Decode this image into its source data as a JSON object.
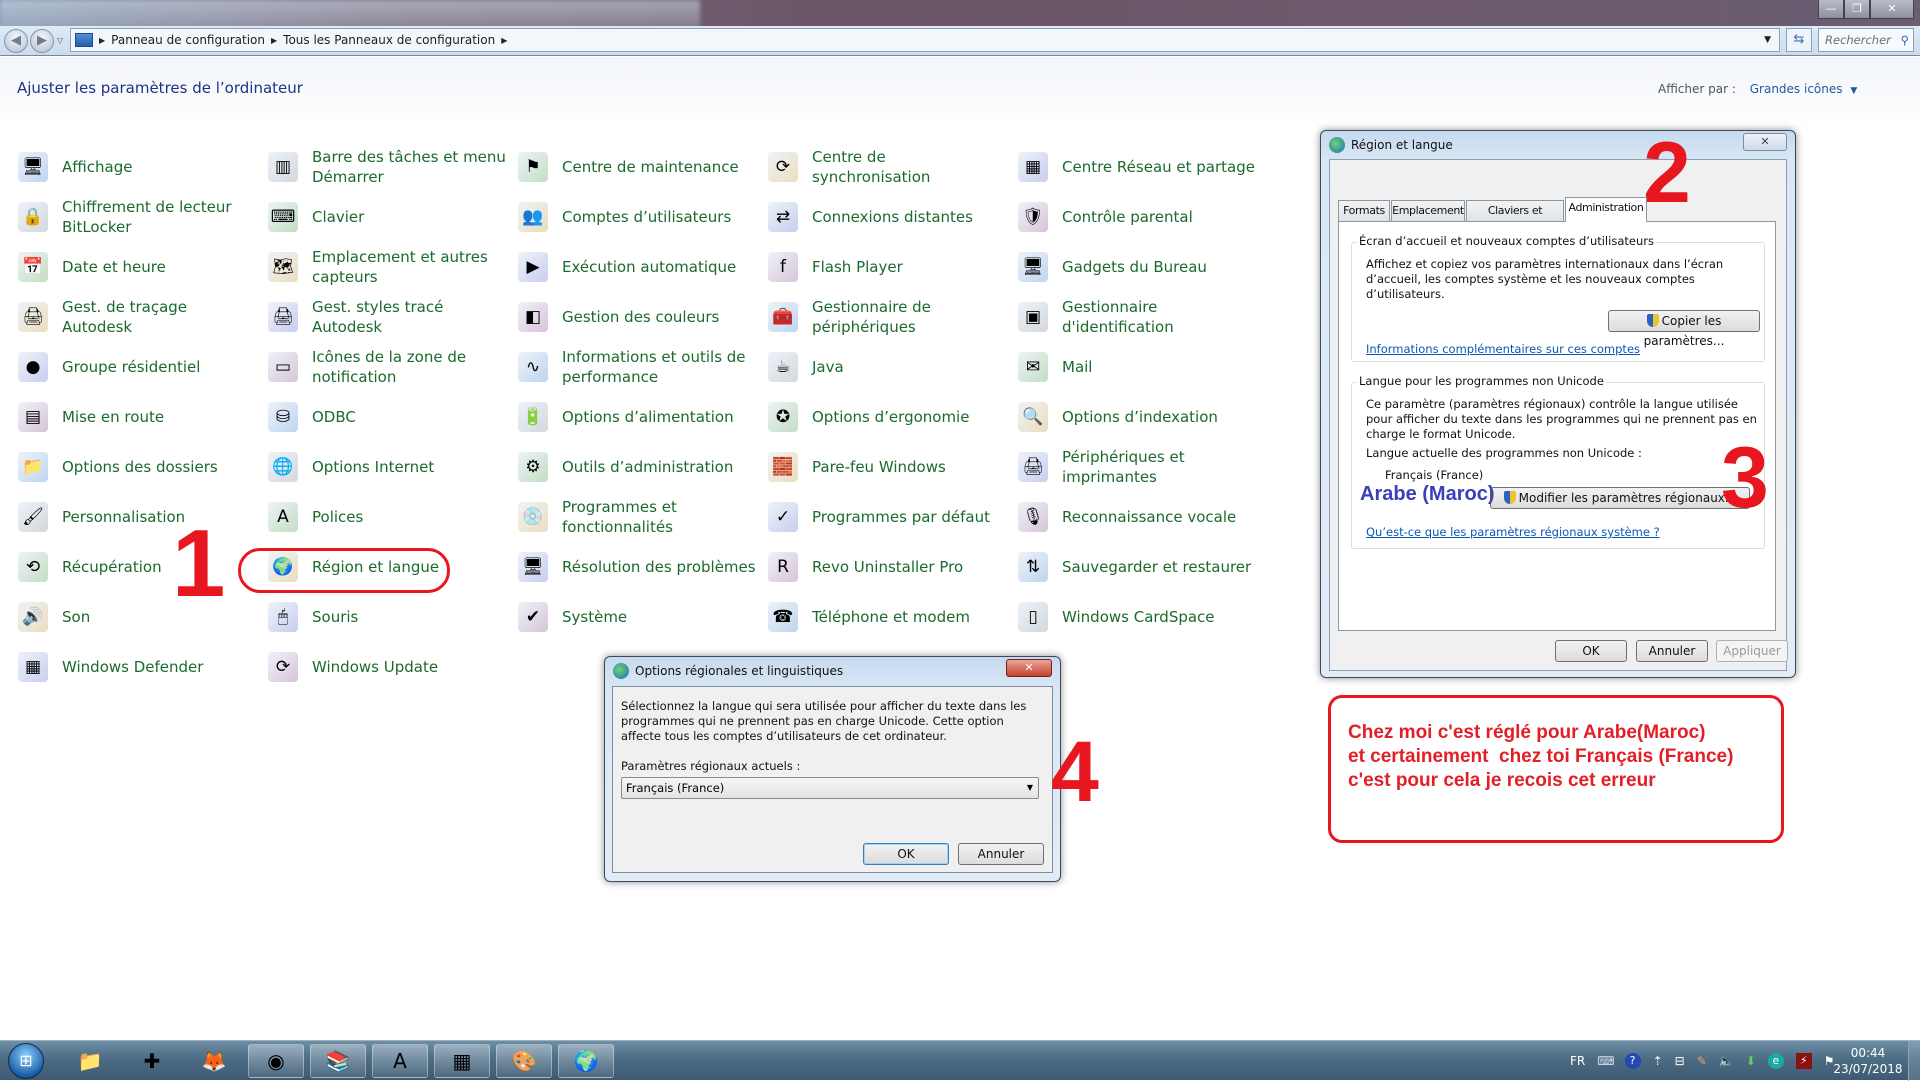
{
  "window": {
    "controls": {
      "minimize": "—",
      "restore": "❐",
      "close": "✕"
    }
  },
  "navbar": {
    "back_icon": "back-arrow-icon",
    "forward_icon": "forward-arrow-icon",
    "breadcrumbs": [
      "Panneau de configuration",
      "Tous les Panneaux de configuration"
    ],
    "search_placeholder": "Rechercher"
  },
  "header": {
    "title": "Ajuster les paramètres de l’ordinateur",
    "view_by_label": "Afficher par :",
    "view_by_value": "Grandes icônes"
  },
  "columns": [
    [
      {
        "label": "Affichage",
        "icon": "display-icon",
        "glyph": "🖥"
      },
      {
        "label": "Chiffrement de lecteur BitLocker",
        "icon": "bitlocker-icon",
        "glyph": "🔒"
      },
      {
        "label": "Date et heure",
        "icon": "date-time-icon",
        "glyph": "📅"
      },
      {
        "label": "Gest. de traçage Autodesk",
        "icon": "autodesk-plotter-icon",
        "glyph": "🖨"
      },
      {
        "label": "Groupe résidentiel",
        "icon": "homegroup-icon",
        "glyph": "●"
      },
      {
        "label": "Mise en route",
        "icon": "getting-started-icon",
        "glyph": "▤"
      },
      {
        "label": "Options des dossiers",
        "icon": "folder-options-icon",
        "glyph": "📁"
      },
      {
        "label": "Personnalisation",
        "icon": "personalization-icon",
        "glyph": "🖌"
      },
      {
        "label": "Récupération",
        "icon": "recovery-icon",
        "glyph": "⟲"
      },
      {
        "label": "Son",
        "icon": "sound-icon",
        "glyph": "🔊"
      },
      {
        "label": "Windows Defender",
        "icon": "defender-icon",
        "glyph": "▦"
      }
    ],
    [
      {
        "label": "Barre des tâches et menu Démarrer",
        "icon": "taskbar-icon",
        "glyph": "▥"
      },
      {
        "label": "Clavier",
        "icon": "keyboard-icon",
        "glyph": "⌨"
      },
      {
        "label": "Emplacement et autres capteurs",
        "icon": "location-sensors-icon",
        "glyph": "🗺"
      },
      {
        "label": "Gest. styles tracé Autodesk",
        "icon": "autodesk-styles-icon",
        "glyph": "🖨"
      },
      {
        "label": "Icônes de la zone de notification",
        "icon": "notification-area-icon",
        "glyph": "▭"
      },
      {
        "label": "ODBC",
        "icon": "odbc-icon",
        "glyph": "⛁"
      },
      {
        "label": "Options Internet",
        "icon": "internet-options-icon",
        "glyph": "🌐"
      },
      {
        "label": "Polices",
        "icon": "fonts-icon",
        "glyph": "A"
      },
      {
        "label": "Région et langue",
        "icon": "region-language-icon",
        "glyph": "🌍"
      },
      {
        "label": "Souris",
        "icon": "mouse-icon",
        "glyph": "🖱"
      },
      {
        "label": "Windows Update",
        "icon": "windows-update-icon",
        "glyph": "⟳"
      }
    ],
    [
      {
        "label": "Centre de maintenance",
        "icon": "action-center-flag-icon",
        "glyph": "⚑"
      },
      {
        "label": "Comptes d’utilisateurs",
        "icon": "user-accounts-icon",
        "glyph": "👥"
      },
      {
        "label": "Exécution automatique",
        "icon": "autoplay-icon",
        "glyph": "▶"
      },
      {
        "label": "Gestion des couleurs",
        "icon": "color-management-icon",
        "glyph": "◧"
      },
      {
        "label": "Informations et outils de performance",
        "icon": "performance-icon",
        "glyph": "∿"
      },
      {
        "label": "Options d’alimentation",
        "icon": "power-options-icon",
        "glyph": "🔋"
      },
      {
        "label": "Outils d’administration",
        "icon": "admin-tools-icon",
        "glyph": "⚙"
      },
      {
        "label": "Programmes et fonctionnalités",
        "icon": "programs-features-icon",
        "glyph": "💿"
      },
      {
        "label": "Résolution des problèmes",
        "icon": "troubleshooting-icon",
        "glyph": "🖥"
      },
      {
        "label": "Système",
        "icon": "system-icon",
        "glyph": "✔"
      }
    ],
    [
      {
        "label": "Centre de synchronisation",
        "icon": "sync-center-icon",
        "glyph": "⟳"
      },
      {
        "label": "Connexions distantes",
        "icon": "remote-connections-icon",
        "glyph": "⇄"
      },
      {
        "label": "Flash Player",
        "icon": "flash-player-icon",
        "glyph": "f"
      },
      {
        "label": "Gestionnaire de périphériques",
        "icon": "device-manager-icon",
        "glyph": "🧰"
      },
      {
        "label": "Java",
        "icon": "java-icon",
        "glyph": "☕"
      },
      {
        "label": "Options d’ergonomie",
        "icon": "ease-of-access-icon",
        "glyph": "✪"
      },
      {
        "label": "Pare-feu Windows",
        "icon": "firewall-icon",
        "glyph": "🧱"
      },
      {
        "label": "Programmes par défaut",
        "icon": "default-programs-icon",
        "glyph": "✓"
      },
      {
        "label": "Revo Uninstaller Pro",
        "icon": "revo-uninstaller-icon",
        "glyph": "R"
      },
      {
        "label": "Téléphone et modem",
        "icon": "phone-modem-icon",
        "glyph": "☎"
      }
    ],
    [
      {
        "label": "Centre Réseau et partage",
        "icon": "network-sharing-icon",
        "glyph": "▦"
      },
      {
        "label": "Contrôle parental",
        "icon": "parental-controls-icon",
        "glyph": "🛡"
      },
      {
        "label": "Gadgets du Bureau",
        "icon": "desktop-gadgets-icon",
        "glyph": "🖥"
      },
      {
        "label": "Gestionnaire d'identification",
        "icon": "credential-manager-icon",
        "glyph": "▣"
      },
      {
        "label": "Mail",
        "icon": "mail-icon",
        "glyph": "✉"
      },
      {
        "label": "Options d’indexation",
        "icon": "indexing-options-icon",
        "glyph": "🔍"
      },
      {
        "label": "Périphériques et imprimantes",
        "icon": "devices-printers-icon",
        "glyph": "🖨"
      },
      {
        "label": "Reconnaissance vocale",
        "icon": "speech-recognition-icon",
        "glyph": "🎙"
      },
      {
        "label": "Sauvegarder et restaurer",
        "icon": "backup-restore-icon",
        "glyph": "⇅"
      },
      {
        "label": "Windows CardSpace",
        "icon": "cardspace-icon",
        "glyph": "▯"
      }
    ]
  ],
  "region_dialog": {
    "title": "Région et langue",
    "close": "✕",
    "tabs": [
      "Formats",
      "Emplacement",
      "Claviers et langues",
      "Administration"
    ],
    "active_tab": "Administration",
    "group1": {
      "title": "Écran d’accueil et nouveaux comptes d’utilisateurs",
      "text": "Affichez et copiez vos paramètres internationaux dans l’écran d’accueil, les comptes système et les nouveaux comptes d’utilisateurs.",
      "button": "Copier les paramètres...",
      "link": "Informations complémentaires sur ces comptes"
    },
    "group2": {
      "title": "Langue pour les programmes non Unicode",
      "text": "Ce paramètre (paramètres régionaux) contrôle la langue utilisée pour afficher du texte dans les programmes qui ne prennent pas en charge le format Unicode.",
      "current_label": "Langue actuelle des programmes non Unicode :",
      "current_value": "Français (France)",
      "button": "Modifier les paramètres régionaux...",
      "link": "Qu’est-ce que les paramètres régionaux système ?"
    },
    "buttons": {
      "ok": "OK",
      "cancel": "Annuler",
      "apply": "Appliquer"
    }
  },
  "options_dialog": {
    "title": "Options régionales et linguistiques",
    "close": "✕",
    "text": "Sélectionnez la langue qui sera utilisée pour afficher du texte dans les programmes qui ne prennent pas en charge Unicode. Cette option affecte tous les comptes d’utilisateurs de cet ordinateur.",
    "select_label": "Paramètres régionaux actuels :",
    "select_value": "Français (France)",
    "buttons": {
      "ok": "OK",
      "cancel": "Annuler"
    }
  },
  "annotations": {
    "step1": "1",
    "step2": "2",
    "step3": "3",
    "step4": "4",
    "overlay_text": "Arabe (Maroc)",
    "note": [
      "Chez moi c'est réglé pour Arabe(Maroc)",
      "et certainement  chez toi Français (France)",
      "c'est pour cela je recois cet erreur"
    ],
    "color": "#e8161e",
    "overlay_color": "#3b3fb8"
  },
  "taskbar": {
    "apps": [
      {
        "name": "explorer",
        "glyph": "📁",
        "open": false
      },
      {
        "name": "teamviewer-security",
        "glyph": "✚",
        "open": false
      },
      {
        "name": "firefox",
        "glyph": "🦊",
        "open": false
      },
      {
        "name": "chrome",
        "glyph": "◉",
        "open": true
      },
      {
        "name": "winrar",
        "glyph": "📚",
        "open": true
      },
      {
        "name": "access",
        "glyph": "A",
        "open": true
      },
      {
        "name": "control-panel",
        "glyph": "▦",
        "open": true
      },
      {
        "name": "paint",
        "glyph": "🎨",
        "open": true
      },
      {
        "name": "region-language",
        "glyph": "🌍",
        "open": true
      }
    ],
    "tray": {
      "language": "FR",
      "time": "00:44",
      "date": "23/07/2018"
    }
  }
}
